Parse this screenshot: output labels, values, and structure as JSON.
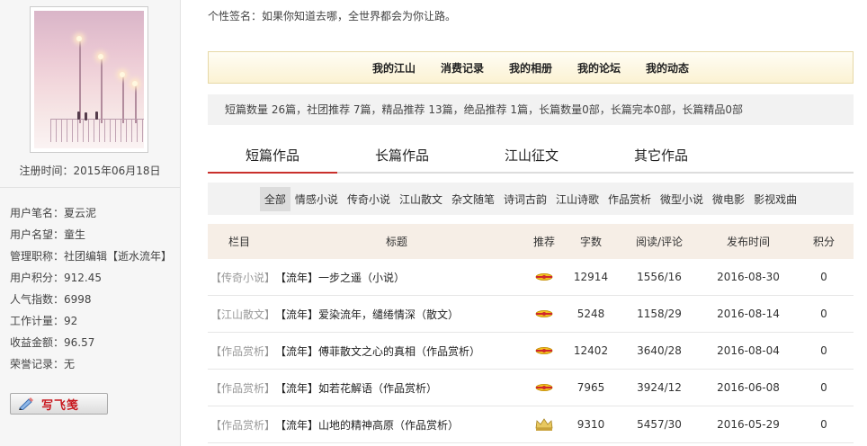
{
  "sidebar": {
    "reg_time": "注册时间：2015年06月18日",
    "info": [
      "用户笔名：夏云泥",
      "用户名望：童生",
      "管理职称：社团编辑【逝水流年】",
      "用户积分：912.45",
      "人气指数：6998",
      "工作计量：92",
      "收益金额：96.57",
      "荣誉记录：无"
    ],
    "write_label": "写飞笺"
  },
  "signature": "个性签名：如果你知道去哪，全世界都会为你让路。",
  "nav": [
    "我的江山",
    "消费记录",
    "我的相册",
    "我的论坛",
    "我的动态"
  ],
  "stats": "短篇数量 26篇，社团推荐 7篇，精品推荐 13篇，绝品推荐 1篇，长篇数量0部，长篇完本0部，长篇精品0部",
  "tabs": [
    "短篇作品",
    "长篇作品",
    "江山征文",
    "其它作品"
  ],
  "categories": [
    "全部",
    "情感小说",
    "传奇小说",
    "江山散文",
    "杂文随笔",
    "诗词古韵",
    "江山诗歌",
    "作品赏析",
    "微型小说",
    "微电影",
    "影视戏曲"
  ],
  "table": {
    "headers": [
      "栏目",
      "标题",
      "推荐",
      "字数",
      "阅读/评论",
      "发布时间",
      "积分"
    ],
    "rows": [
      {
        "column": "【传奇小说】",
        "title": "【流年】一步之遥（小说）",
        "rec": "medal",
        "words": "12914",
        "reads": "1556/16",
        "date": "2016-08-30",
        "score": "0"
      },
      {
        "column": "【江山散文】",
        "title": "【流年】爱染流年，缱绻情深（散文）",
        "rec": "medal",
        "words": "5248",
        "reads": "1158/29",
        "date": "2016-08-14",
        "score": "0"
      },
      {
        "column": "【作品赏析】",
        "title": "【流年】傅菲散文之心的真相（作品赏析）",
        "rec": "medal",
        "words": "12402",
        "reads": "3640/28",
        "date": "2016-08-04",
        "score": "0"
      },
      {
        "column": "【作品赏析】",
        "title": "【流年】如若花解语（作品赏析）",
        "rec": "medal",
        "words": "7965",
        "reads": "3924/12",
        "date": "2016-06-08",
        "score": "0"
      },
      {
        "column": "【作品赏析】",
        "title": "【流年】山地的精神高原（作品赏析）",
        "rec": "crown",
        "words": "9310",
        "reads": "5457/30",
        "date": "2016-05-29",
        "score": "0"
      }
    ]
  }
}
